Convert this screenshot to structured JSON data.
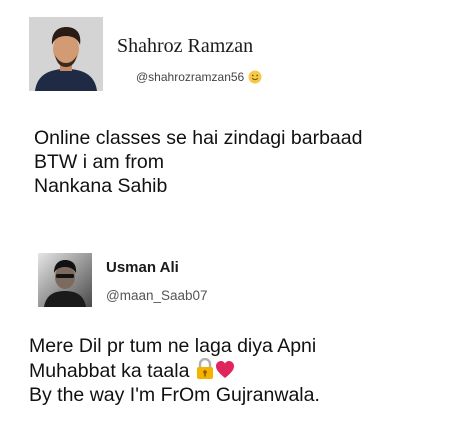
{
  "post_1": {
    "author_name": "Shahroz Ramzan",
    "author_handle": "@shahrozramzan56",
    "handle_emoji": "smiley-face-icon",
    "text_lines": [
      "Online classes se hai zindagi barbaad",
      "BTW i am from",
      "Nankana Sahib"
    ]
  },
  "post_2": {
    "author_name": "Usman Ali",
    "author_handle": "@maan_Saab07",
    "text_lines": [
      "Mere Dil pr tum ne laga diya Apni",
      "Muhabbat ka taala",
      "By the way I'm FrOm Gujranwala."
    ],
    "inline_emojis": [
      "lock-with-key-icon",
      "red-heart-icon"
    ]
  },
  "colors": {
    "background": "#ffffff",
    "text": "#111111",
    "handle_text": "#555555",
    "heart": "#e0245e",
    "lock": "#f5b301"
  }
}
